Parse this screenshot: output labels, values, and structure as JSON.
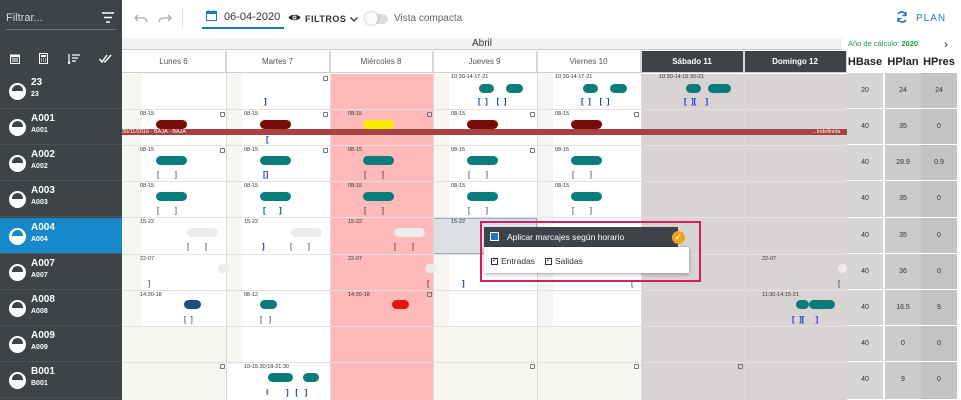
{
  "sidebar": {
    "filter_placeholder": "Filtrar...",
    "employees": [
      {
        "name": "23",
        "code": "23"
      },
      {
        "name": "A001",
        "code": "A001"
      },
      {
        "name": "A002",
        "code": "A002"
      },
      {
        "name": "A003",
        "code": "A003"
      },
      {
        "name": "A004",
        "code": "A004"
      },
      {
        "name": "A007",
        "code": "A007"
      },
      {
        "name": "A008",
        "code": "A008"
      },
      {
        "name": "A009",
        "code": "A009"
      },
      {
        "name": "B001",
        "code": "B001"
      }
    ],
    "selected_index": 4
  },
  "toolbar": {
    "date": "06-04-2020",
    "filters_label": "FILTROS",
    "compact_label": "Vista compacta",
    "plan_label": "PLAN"
  },
  "calendar": {
    "month": "Abril",
    "calc_year_label": "Año de cálculo:",
    "calc_year": "2020",
    "days": [
      "Lunes 6",
      "Martes 7",
      "Miércoles 8",
      "Jueves 9",
      "Viernes 10",
      "Sábado 11",
      "Domingo 12"
    ],
    "hours_headers": [
      "HBase",
      "HPlan",
      "HPres"
    ],
    "baja_start_label": "30/11/2016 - BAJA - BAJA",
    "baja_end_label": "...Indefinida"
  },
  "hours": [
    [
      "20",
      "24",
      "24"
    ],
    [
      "40",
      "35",
      "0"
    ],
    [
      "40",
      "28.9",
      "0.9"
    ],
    [
      "40",
      "35",
      "0"
    ],
    [
      "40",
      "35",
      "0"
    ],
    [
      "40",
      "36",
      "0"
    ],
    [
      "40",
      "16.5",
      "9"
    ],
    [
      "40",
      "0",
      "0"
    ],
    [
      "40",
      "9",
      "0"
    ]
  ],
  "schedules": {
    "r0": {
      "jue": "10:30-14:17-21",
      "vie": "10:30-14:17-21",
      "sab": "10:30-14:15:30-21"
    },
    "r1": {
      "lun": "08-15",
      "mar": "08-15",
      "mie": "08-15",
      "jue": "08-15",
      "vie": "08-15"
    },
    "r2": {
      "lun": "08-15",
      "mar": "08-15",
      "mie": "08-15",
      "jue": "08-15",
      "vie": "08-15"
    },
    "r3": {
      "lun": "08-15",
      "mar": "08-15",
      "mie": "08-15",
      "jue": "08-15",
      "vie": "08-15"
    },
    "r4": {
      "lun": "15-22",
      "mar": "15-22",
      "mie": "15-22",
      "jue": "15-22"
    },
    "r5": {
      "lun": "22-07",
      "mie": "22-07",
      "dom": "22-07"
    },
    "r6": {
      "lun": "14:30-18",
      "mar": "08-12",
      "mie": "14:30-18",
      "dom": "11:30-14:15-21"
    },
    "r8": {
      "mar": "10-15:30;18-21:30"
    }
  },
  "popup": {
    "title": "Aplicar marcajes según horario",
    "entradas_label": "Entradas",
    "salidas_label": "Salidas"
  },
  "colors": {
    "teal": "#0a7d7a",
    "darkred": "#7a0b0b",
    "yellow": "#f5ee00",
    "navy": "#1a4c8c",
    "red": "#e8150f",
    "holiday_pink": "#ffb9b9",
    "weekend_gray": "#d9d3d3",
    "selected_blue": "#1788c9"
  }
}
